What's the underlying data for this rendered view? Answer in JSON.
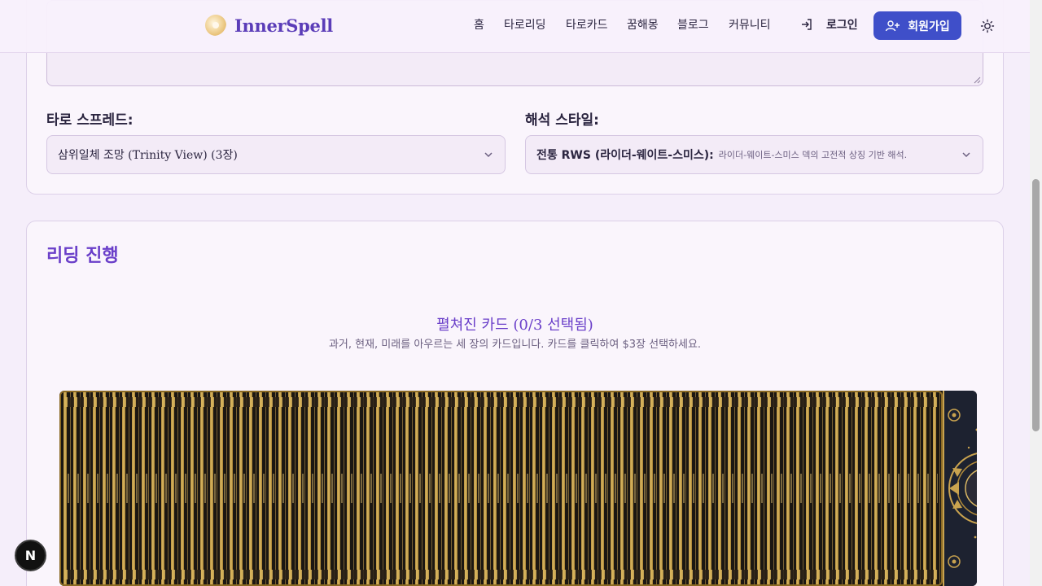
{
  "header": {
    "logo_text": "InnerSpell",
    "nav": [
      {
        "label": "홈"
      },
      {
        "label": "타로리딩"
      },
      {
        "label": "타로카드"
      },
      {
        "label": "꿈해몽"
      },
      {
        "label": "블로그"
      },
      {
        "label": "커뮤니티"
      }
    ],
    "login_label": "로그인",
    "signup_label": "회원가입"
  },
  "settings": {
    "spread_label": "타로 스프레드:",
    "spread_value": "삼위일체 조망 (Trinity View) (3장)",
    "style_label": "해석 스타일:",
    "style_value": "전통 RWS (라이더-웨이트-스미스):",
    "style_desc": "라이더-웨이트-스미스 덱의 고전적 상징 기반 해석."
  },
  "reading": {
    "title": "리딩 진행",
    "spread_title": "펼쳐진 카드 (0/3 선택됨)",
    "spread_sub": "과거, 현재, 미래를 아우르는 세 장의 카드입니다. 카드를 클릭하여 $3장 선택하세요.",
    "selected": 0,
    "total": 3
  },
  "badge_label": "N",
  "colors": {
    "accent": "#6a3fc9",
    "signup_bg": "#3f4fc9",
    "page_bg": "#f5eefa",
    "deck_gold": "#c9a34f"
  }
}
